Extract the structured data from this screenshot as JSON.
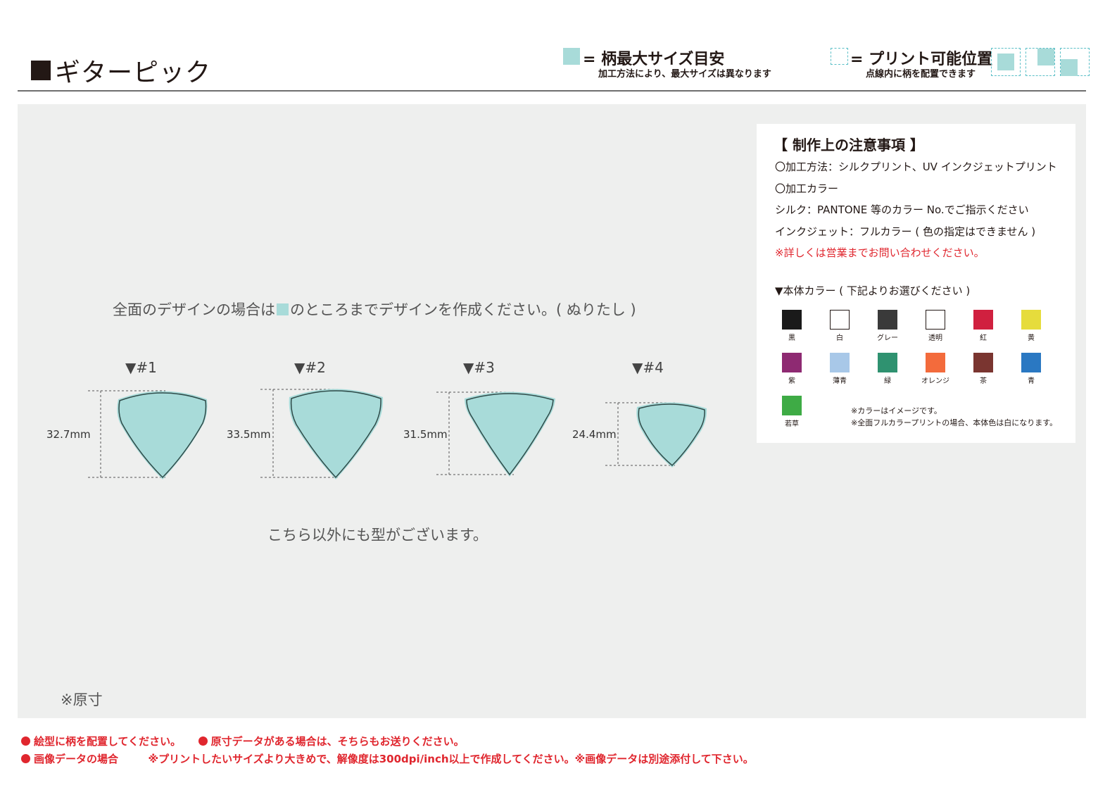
{
  "header": {
    "title": "ギターピック",
    "legend_max": {
      "label": "= 柄最大サイズ目安",
      "sub": "加工方法により、最大サイズは異なります"
    },
    "legend_print": {
      "label": "= プリント可能位置",
      "sub": "点線内に柄を配置できます"
    }
  },
  "main": {
    "instruction_before": "全面のデザインの場合は",
    "instruction_after": "のところまでデザインを作成ください。( ぬりたし )",
    "picks": [
      {
        "label": "▼#1",
        "height": "32.7mm"
      },
      {
        "label": "▼#2",
        "height": "33.5mm"
      },
      {
        "label": "▼#3",
        "height": "31.5mm"
      },
      {
        "label": "▼#4",
        "height": "24.4mm"
      }
    ],
    "other_types": "こちら以外にも型がございます。",
    "actual_size": "※原寸"
  },
  "notes": {
    "heading": "【 制作上の注意事項 】",
    "lines": [
      "〇加工方法：シルクプリント、UV インクジェットプリント",
      "〇加工カラー",
      "シルク：PANTONE 等のカラー No.でご指示ください",
      "インクジェット：フルカラー ( 色の指定はできません )"
    ],
    "red_note": "※詳しくは営業までお問い合わせください。",
    "body_color_heading": "▼本体カラー ( 下記よりお選びください )",
    "colors": [
      {
        "name": "黒",
        "hex": "#1a1a1a"
      },
      {
        "name": "白",
        "hex": "#ffffff"
      },
      {
        "name": "グレー",
        "hex": "#3a3a3a"
      },
      {
        "name": "透明",
        "hex": "#ffffff"
      },
      {
        "name": "紅",
        "hex": "#d0203f"
      },
      {
        "name": "黄",
        "hex": "#e6dc3c"
      },
      {
        "name": "紫",
        "hex": "#8e2a72"
      },
      {
        "name": "薄青",
        "hex": "#a8c8e8"
      },
      {
        "name": "緑",
        "hex": "#2f9270"
      },
      {
        "name": "オレンジ",
        "hex": "#f36b3c"
      },
      {
        "name": "茶",
        "hex": "#7a3530"
      },
      {
        "name": "青",
        "hex": "#2a78c2"
      },
      {
        "name": "若草",
        "hex": "#3eab45"
      }
    ],
    "color_note_1": "※カラーはイメージです。",
    "color_note_2": "※全面フルカラープリントの場合、本体色は白になります。"
  },
  "footer": {
    "item1": "絵型に柄を配置してください。",
    "item2": "原寸データがある場合は、そちらもお送りください。",
    "item3": "画像データの場合",
    "item3_detail": "※プリントしたいサイズより大きめで、解像度は300dpi/inch以上で作成してください。※画像データは別途添付して下さい。"
  },
  "colors": {
    "accent": "#a8dbd9",
    "guide": "#5bbfc7",
    "red": "#e0262e",
    "panel": "#eeefee"
  }
}
